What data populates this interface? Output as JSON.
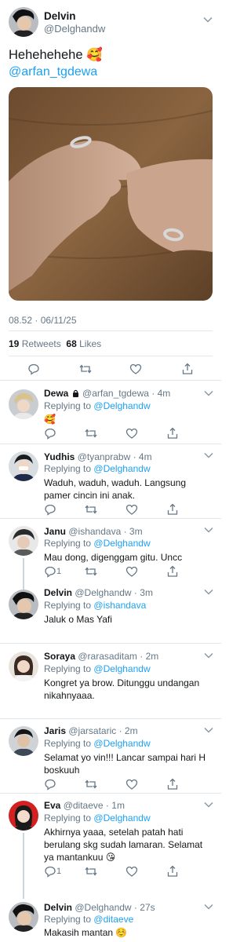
{
  "colors": {
    "accent": "#1da1f2",
    "text": "#14171a",
    "muted": "#657786",
    "divider": "#e1e8ed"
  },
  "main_tweet": {
    "name": "Delvin",
    "handle": "@Delghandw",
    "text": "Hehehehehe 🥰",
    "mention": "@arfan_tgdewa",
    "timestamp": "08.52 · 06/11/25",
    "retweets_count": "19",
    "retweets_label": "Retweets",
    "likes_count": "68",
    "likes_label": "Likes"
  },
  "replies": [
    {
      "name": "Dewa",
      "handle": "@arfan_tgdewa",
      "time": "4m",
      "locked": true,
      "replying_label": "Replying to",
      "replying_to": "@Delghandw",
      "text": "🥰"
    },
    {
      "name": "Yudhis",
      "handle": "@tyanprabw",
      "time": "4m",
      "replying_label": "Replying to",
      "replying_to": "@Delghandw",
      "text": "Waduh, waduh, waduh. Langsung pamer cincin ini anak."
    },
    {
      "name": "Janu",
      "handle": "@ishandava",
      "time": "3m",
      "replying_label": "Replying to",
      "replying_to": "@Delghandw",
      "text": "Mau dong, digenggam gitu. Uncc",
      "reply_count": "1"
    },
    {
      "name": "Delvin",
      "handle": "@Delghandw",
      "time": "3m",
      "replying_label": "Replying to",
      "replying_to": "@ishandava",
      "text": "Jaluk o Mas Yafi"
    },
    {
      "name": "Soraya",
      "handle": "@rarasaditam",
      "time": "2m",
      "replying_label": "Replying to",
      "replying_to": "@Delghandw",
      "text": "Kongret ya brow. Ditunggu undangan nikahnyaaa."
    },
    {
      "name": "Jaris",
      "handle": "@jarsataric",
      "time": "2m",
      "replying_label": "Replying to",
      "replying_to": "@Delghandw",
      "text": "Selamat yo vin!!! Lancar sampai hari H boskuuh"
    },
    {
      "name": "Eva",
      "handle": "@ditaeve",
      "time": "1m",
      "replying_label": "Replying to",
      "replying_to": "@Delghandw",
      "text": "Akhirnya yaaa, setelah patah hati berulang skg sudah lamaran. Selamat ya mantankuu 😘",
      "reply_count": "1"
    },
    {
      "name": "Delvin",
      "handle": "@Delghandw",
      "time": "27s",
      "replying_label": "Replying to",
      "replying_to": "@ditaeve",
      "text": "Makasih mantan ☺️"
    }
  ]
}
